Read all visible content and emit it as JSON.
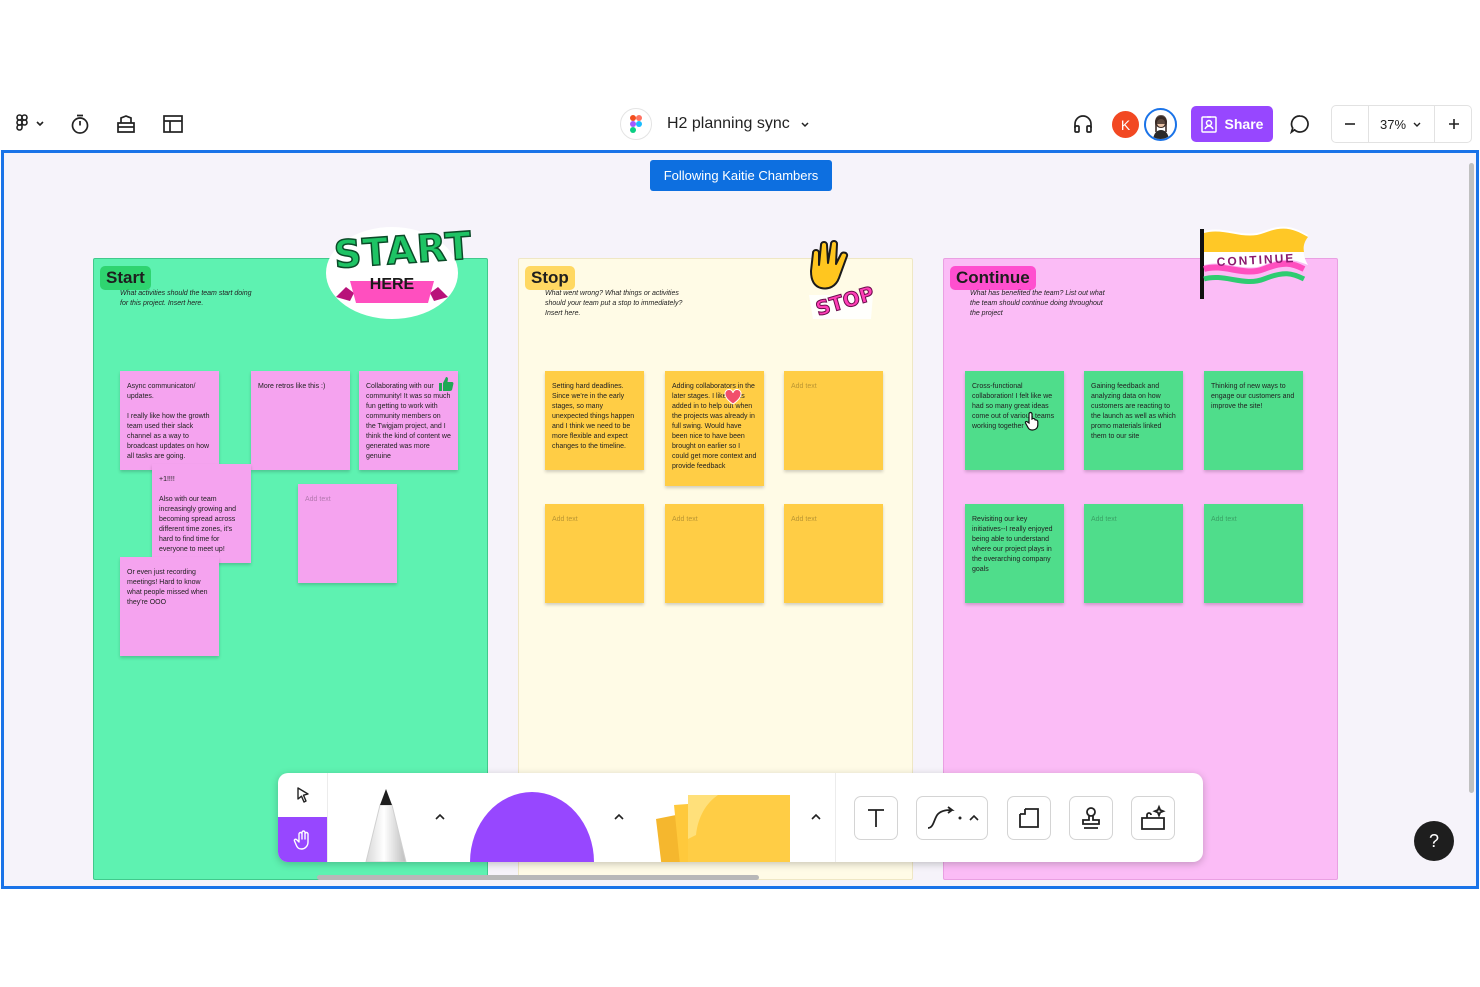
{
  "header": {
    "file_title": "H2 planning sync",
    "avatar_initial": "K",
    "share_label": "Share",
    "zoom": "37%"
  },
  "canvas": {
    "follow_banner": "Following Kaitie Chambers"
  },
  "sections": {
    "start": {
      "title": "Start",
      "description": "What activities should the team start doing for this project. Insert here.",
      "sticker_top": "START",
      "sticker_bottom": "HERE",
      "notes": [
        "Async communicaton/ updates.\n\nI really like how the growth team used their slack channel as a way to broadcast updates on how all tasks are going.",
        "More retros like this :)",
        "Collaborating with our community! It was so much fun getting to work with community members on the Twigjam project, and I think the kind of content we generated was more genuine",
        "+1!!!!\n\nAlso with our team increasingly growing and becoming spread across different time zones, it's hard to find time for everyone to meet up!",
        "Add text",
        "Or even just recording meetings! Hard to know what people missed when they're OOO"
      ]
    },
    "stop": {
      "title": "Stop",
      "description": "What went wrong? What things or activities should your team put a stop to immediately? Insert here.",
      "sticker": "STOP",
      "notes": [
        "Setting hard deadlines. Since we're in the early stages, so many unexpected things happen and I think we need to be more flexible and expect changes to the timeline.",
        "Adding collaborators in the later stages. I like I was added in to help out when the projects was already in full swing. Would have been nice to have been brought on earlier so I could get more context and provide feedback",
        "Add text",
        "Add text",
        "Add text",
        "Add text"
      ]
    },
    "continue": {
      "title": "Continue",
      "description": "What has benefited the team? List out what the team should continue doing throughout the project",
      "sticker": "CONTINUE",
      "notes": [
        "Cross-functional collaboration! I felt like we had so many great ideas come out of various teams working together",
        "Gaining feedback and analyzing data on how customers are reacting to the launch as well as which promo materials linked them to our site",
        "Thinking of new ways to engage our customers and improve the site!",
        "Revisiting our key initiatives--I really enjoyed being able to understand where our project plays in the overarching company goals",
        "Add text",
        "Add text"
      ]
    }
  },
  "help": {
    "label": "?"
  },
  "colors": {
    "selection_blue": "#1a73e8",
    "share_purple": "#9747ff",
    "start_bg": "#5ef2b1",
    "stop_bg": "#fffbe6",
    "continue_bg": "#fbbcf6",
    "sticky_pink": "#f5a3ef",
    "sticky_yellow": "#ffcd45",
    "sticky_green": "#4fdd8b"
  }
}
